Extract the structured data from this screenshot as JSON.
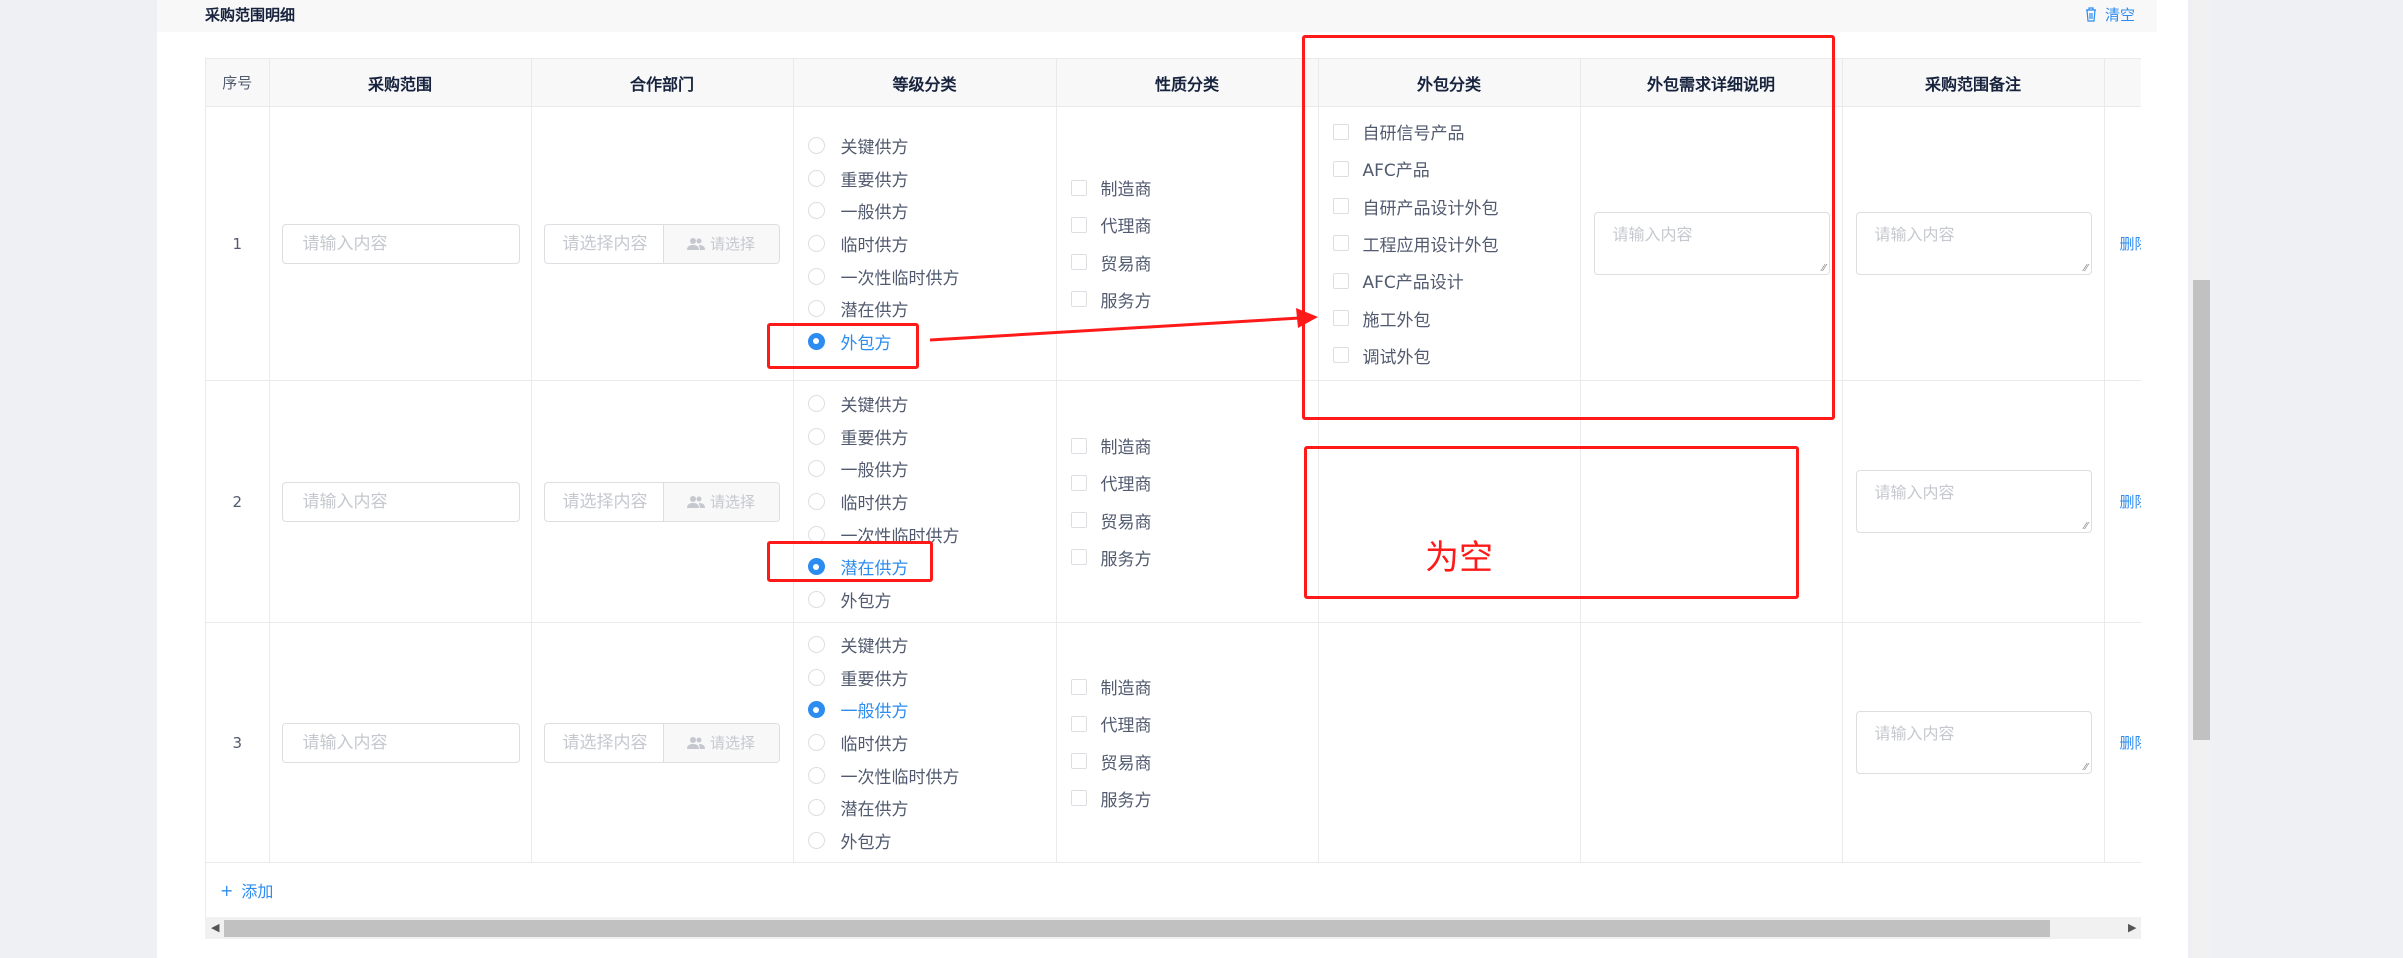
{
  "section": {
    "title": "采购范围明细",
    "clear_label": "清空"
  },
  "columns": [
    "序号",
    "采购范围",
    "合作部门",
    "等级分类",
    "性质分类",
    "外包分类",
    "外包需求详细说明",
    "采购范围备注",
    ""
  ],
  "placeholders": {
    "input": "请输入内容",
    "select": "请选择内容",
    "select_button": "请选择",
    "textarea": "请输入内容"
  },
  "grade_options": [
    "关键供方",
    "重要供方",
    "一般供方",
    "临时供方",
    "一次性临时供方",
    "潜在供方",
    "外包方"
  ],
  "nature_options": [
    "制造商",
    "代理商",
    "贸易商",
    "服务方"
  ],
  "outsource_options": [
    "自研信号产品",
    "AFC产品",
    "自研产品设计外包",
    "工程应用设计外包",
    "AFC产品设计",
    "施工外包",
    "调试外包"
  ],
  "rows": [
    {
      "index": "1",
      "grade_selected": "外包方",
      "has_outsource": true
    },
    {
      "index": "2",
      "grade_selected": "潜在供方",
      "has_outsource": false
    },
    {
      "index": "3",
      "grade_selected": "一般供方",
      "has_outsource": false
    }
  ],
  "delete_label": "删除",
  "add_label": "添加",
  "annotation": {
    "empty_note": "为空",
    "color": "#ff1a1a"
  },
  "accent": "#2d8cf0"
}
